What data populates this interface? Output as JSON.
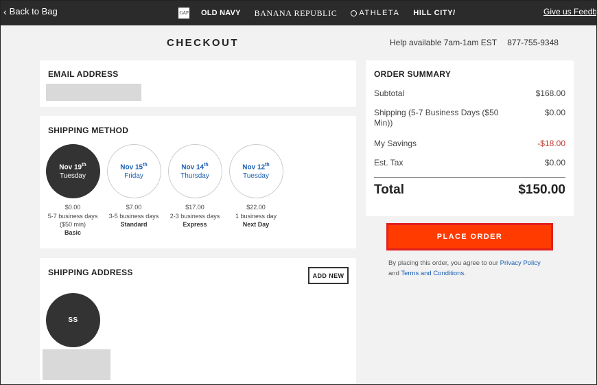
{
  "topbar": {
    "back_label": "Back to Bag",
    "gap_logo": "GAP",
    "brands": [
      "OLD NAVY",
      "BANANA REPUBLIC",
      "ATHLETA",
      "HILL CITY/"
    ],
    "feedback": "Give us Feedba"
  },
  "page": {
    "title": "CHECKOUT",
    "help_text": "Help available 7am-1am EST",
    "help_phone": "877-755-9348"
  },
  "email": {
    "title": "EMAIL ADDRESS"
  },
  "shipping_method": {
    "title": "SHIPPING METHOD",
    "options": [
      {
        "day": "Nov 19",
        "suffix": "th",
        "weekday": "Tuesday",
        "price": "$0.00",
        "days": "5-7 business days ($50 min)",
        "name": "Basic",
        "selected": true
      },
      {
        "day": "Nov 15",
        "suffix": "th",
        "weekday": "Friday",
        "price": "$7.00",
        "days": "3-5 business days",
        "name": "Standard",
        "selected": false
      },
      {
        "day": "Nov 14",
        "suffix": "th",
        "weekday": "Thursday",
        "price": "$17.00",
        "days": "2-3 business days",
        "name": "Express",
        "selected": false
      },
      {
        "day": "Nov 12",
        "suffix": "th",
        "weekday": "Tuesday",
        "price": "$22.00",
        "days": "1 business day",
        "name": "Next Day",
        "selected": false
      }
    ]
  },
  "shipping_address": {
    "title": "SHIPPING ADDRESS",
    "add_new": "ADD NEW",
    "initials": "SS"
  },
  "summary": {
    "title": "ORDER SUMMARY",
    "rows": [
      {
        "label": "Subtotal",
        "value": "$168.00"
      },
      {
        "label": "Shipping  (5-7 Business Days ($50 Min))",
        "value": "$0.00"
      },
      {
        "label": "My Savings",
        "value": "-$18.00"
      },
      {
        "label": "Est. Tax",
        "value": "$0.00"
      }
    ],
    "total_label": "Total",
    "total_value": "$150.00"
  },
  "place_order": "PLACE ORDER",
  "terms": {
    "prefix": "By placing this order, you agree to our",
    "privacy": "Privacy Policy",
    "and": "and",
    "conditions": "Terms and Conditions."
  },
  "colors": {
    "topbar": "#2b2b2b",
    "accent_link": "#1a5fb4",
    "place_order": "#ff3b00",
    "place_order_border": "#e02020",
    "savings": "#c0392b"
  }
}
